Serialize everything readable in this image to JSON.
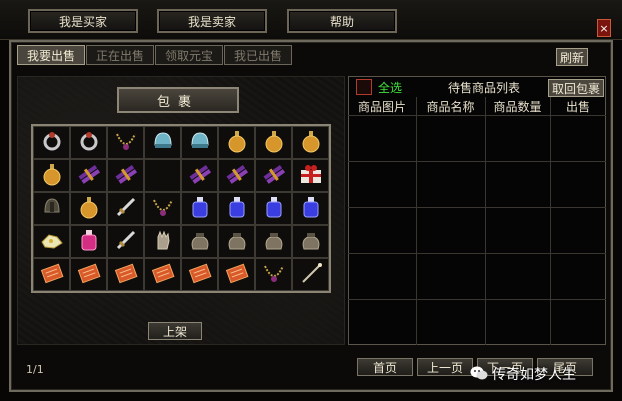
{
  "top_buttons": [
    "我是买家",
    "我是卖家",
    "帮助"
  ],
  "close_label": "×",
  "tabs": [
    {
      "label": "我要出售",
      "active": true
    },
    {
      "label": "正在出售",
      "active": false
    },
    {
      "label": "领取元宝",
      "active": false
    },
    {
      "label": "我已出售",
      "active": false
    }
  ],
  "refresh_label": "刷新",
  "bag_title": "包裹",
  "inventory": [
    [
      "ring-icon",
      "ring-icon",
      "necklace-icon",
      "helmet-icon",
      "helmet-icon",
      "potion-gold-icon",
      "potion-gold-icon",
      "potion-gold-icon"
    ],
    [
      "potion-gold-icon",
      "scroll-bundle-icon",
      "scroll-bundle-icon",
      "",
      "scroll-bundle-icon",
      "scroll-bundle-icon",
      "scroll-bundle-icon",
      "gift-box-icon"
    ],
    [
      "helmet-dark-icon",
      "potion-gold-icon",
      "sword-icon",
      "necklace-icon",
      "potion-blue-icon",
      "potion-blue-icon",
      "potion-blue-icon",
      "potion-blue-icon"
    ],
    [
      "ore-icon",
      "potion-pink-icon",
      "sword-icon",
      "glove-icon",
      "pouch-icon",
      "pouch-icon",
      "pouch-icon",
      "pouch-icon"
    ],
    [
      "book-icon",
      "book-icon",
      "book-icon",
      "book-icon",
      "book-icon",
      "book-icon",
      "necklace-icon",
      "wand-icon"
    ]
  ],
  "shelve_label": "上架",
  "select_all_label": "全选",
  "list_title": "待售商品列表",
  "retrieve_label": "取回包裹",
  "table_headers": [
    "商品图片",
    "商品名称",
    "商品数量",
    "出售"
  ],
  "page_indicator": "1/1",
  "nav_buttons": [
    "首页",
    "上一页",
    "下一页",
    "尾页"
  ],
  "watermark": "传奇如梦人生",
  "colors": {
    "select_all": "#3fe03a",
    "close": "#7b140c",
    "frame": "#6f6a5e"
  }
}
